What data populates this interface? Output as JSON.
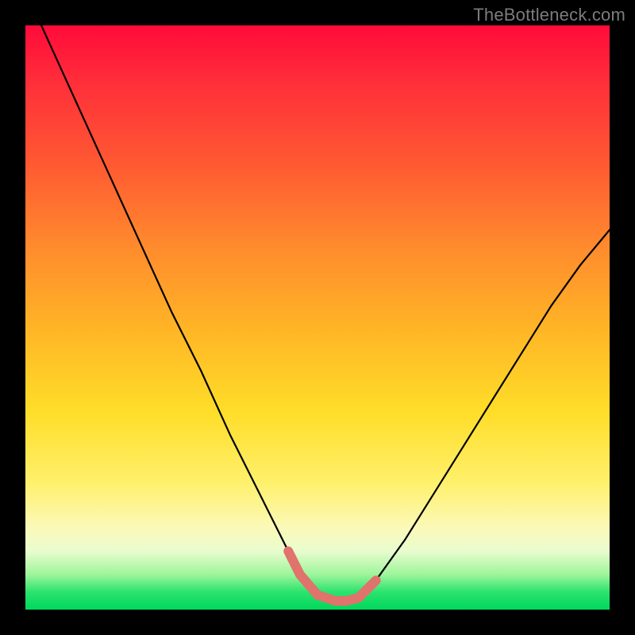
{
  "watermark": "TheBottleneck.com",
  "colors": {
    "frame": "#000000",
    "curve_stroke": "#000000",
    "thick_stroke": "#e0736b",
    "gradient_top": "#ff0b3a",
    "gradient_bottom": "#00d85c"
  },
  "chart_data": {
    "type": "line",
    "title": "",
    "xlabel": "",
    "ylabel": "",
    "xlim": [
      0,
      100
    ],
    "ylim": [
      0,
      100
    ],
    "x": [
      0,
      5,
      10,
      15,
      20,
      25,
      30,
      35,
      40,
      45,
      47,
      50,
      53,
      55,
      57,
      60,
      65,
      70,
      75,
      80,
      85,
      90,
      95,
      100
    ],
    "values": [
      106,
      95,
      84,
      73,
      62,
      51,
      41,
      30,
      20,
      10,
      6,
      2.5,
      1.5,
      1.5,
      2,
      5,
      12,
      20,
      28,
      36,
      44,
      52,
      59,
      65
    ],
    "series": [
      {
        "name": "bottleneck-curve",
        "x": [
          0,
          5,
          10,
          15,
          20,
          25,
          30,
          35,
          40,
          45,
          47,
          50,
          53,
          55,
          57,
          60,
          65,
          70,
          75,
          80,
          85,
          90,
          95,
          100
        ],
        "y": [
          106,
          95,
          84,
          73,
          62,
          51,
          41,
          30,
          20,
          10,
          6,
          2.5,
          1.5,
          1.5,
          2,
          5,
          12,
          20,
          28,
          36,
          44,
          52,
          59,
          65
        ]
      },
      {
        "name": "sweet-spot-highlight",
        "x": [
          45,
          47,
          50,
          53,
          55,
          57,
          60
        ],
        "y": [
          10,
          6,
          2.5,
          1.5,
          1.5,
          2,
          5
        ]
      }
    ],
    "annotations": []
  }
}
